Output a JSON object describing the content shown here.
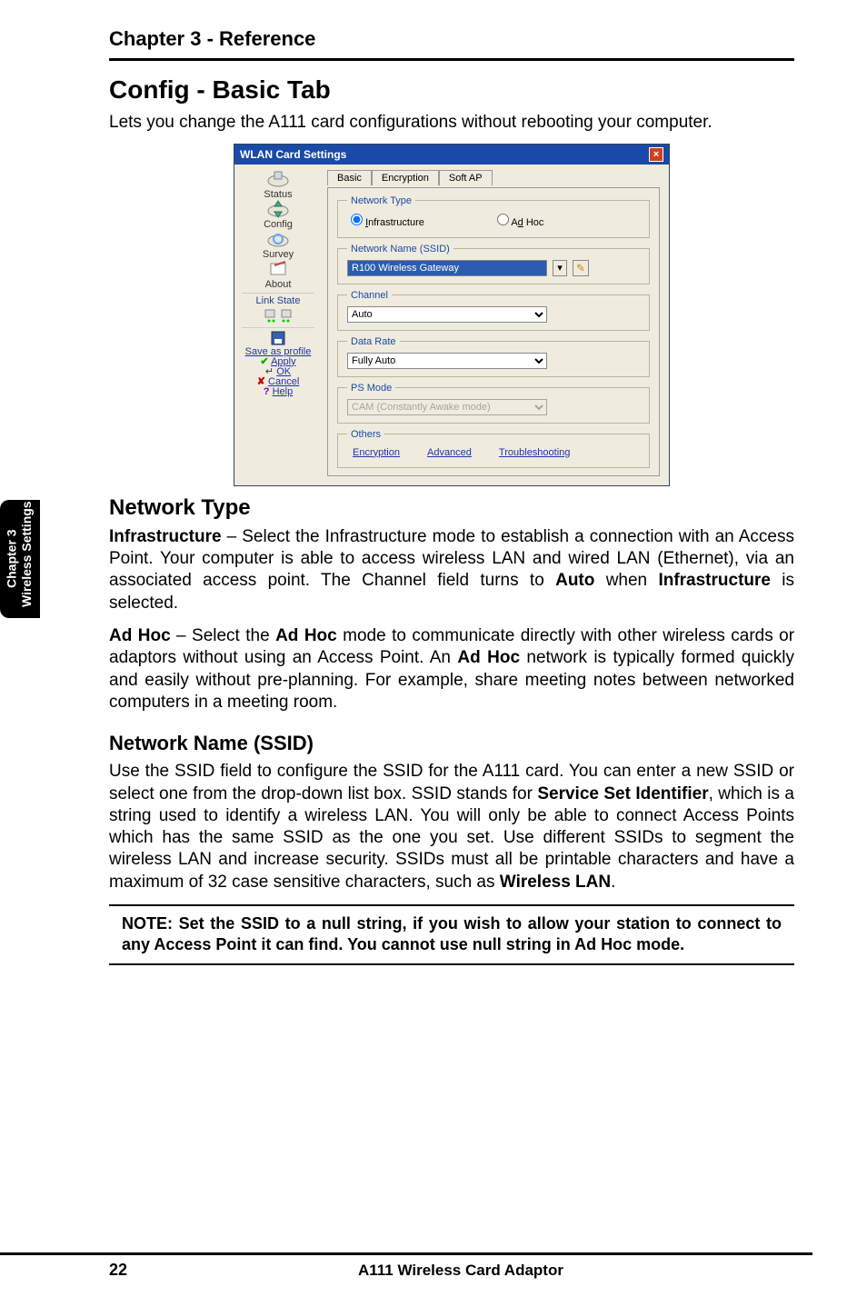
{
  "chapterHead": "Chapter 3 - Reference",
  "sectionTitle": "Config - Basic Tab",
  "leadText": "Lets you change the A111 card configurations without rebooting your computer.",
  "sideTab": {
    "line1": "Chapter 3",
    "line2": "Wireless Settings"
  },
  "dialog": {
    "title": "WLAN Card Settings",
    "closeSymbol": "×",
    "sidebar": {
      "status": "Status",
      "config": "Config",
      "survey": "Survey",
      "about": "About",
      "linkState": "Link State",
      "saveProfile": "Save as profile",
      "apply": "Apply",
      "ok": "OK",
      "cancel": "Cancel",
      "help": "Help"
    },
    "tabs": {
      "basic": "Basic",
      "encryption": "Encryption",
      "softap": "Soft AP"
    },
    "groups": {
      "networkType": {
        "legend": "Network Type",
        "infrastructure": "Infrastructure",
        "adhoc": "Ad Hoc"
      },
      "ssid": {
        "legend": "Network Name (SSID)",
        "value": "R100 Wireless Gateway",
        "surveyIcon": "✎"
      },
      "channel": {
        "legend": "Channel",
        "value": "Auto"
      },
      "dataRate": {
        "legend": "Data Rate",
        "value": "Fully Auto"
      },
      "psMode": {
        "legend": "PS Mode",
        "value": "CAM (Constantly Awake mode)"
      },
      "others": {
        "legend": "Others",
        "links": {
          "encryption": "Encryption",
          "advanced": "Advanced",
          "troubleshooting": "Troubleshooting"
        }
      }
    }
  },
  "networkTypeHeading": "Network Type",
  "para_infra_a": "Infrastructure",
  "para_infra_b": " – Select the Infrastructure mode to establish a connection with an Access Point. Your computer is able to access wireless LAN and wired LAN (Ethernet), via an associated access point. The Channel field turns to ",
  "para_infra_c": "Auto",
  "para_infra_d": " when ",
  "para_infra_e": "Infrastructure",
  "para_infra_f": " is selected.",
  "para_adhoc_a": "Ad Hoc",
  "para_adhoc_b": " – Select the ",
  "para_adhoc_c": "Ad Hoc",
  "para_adhoc_d": " mode to communicate directly with other wireless cards or adaptors without using an Access Point. An ",
  "para_adhoc_e": "Ad Hoc",
  "para_adhoc_f": " network is typically formed quickly and easily without pre-planning. For example, share meeting notes between networked computers in a meeting room.",
  "ssidHeading": "Network Name (SSID)",
  "para_ssid_a": "Use the SSID field to configure the SSID for the A111 card. You can enter a new SSID or select one from the drop-down list box. SSID stands for ",
  "para_ssid_b": "Service Set Identifier",
  "para_ssid_c": ", which is a string used to identify a wireless LAN. You will only be able to connect Access Points which has the same SSID as the one you set. Use different SSIDs to segment the wireless LAN and increase security. SSIDs must all be printable characters and have a maximum of 32 case sensitive characters, such as ",
  "para_ssid_d": "Wireless LAN",
  "para_ssid_e": ".",
  "noteText": "NOTE: Set the SSID to a null string, if you wish to allow your station to connect to any Access Point it can find. You cannot use null string in Ad Hoc mode.",
  "footer": {
    "page": "22",
    "title": "A111 Wireless Card Adaptor"
  }
}
